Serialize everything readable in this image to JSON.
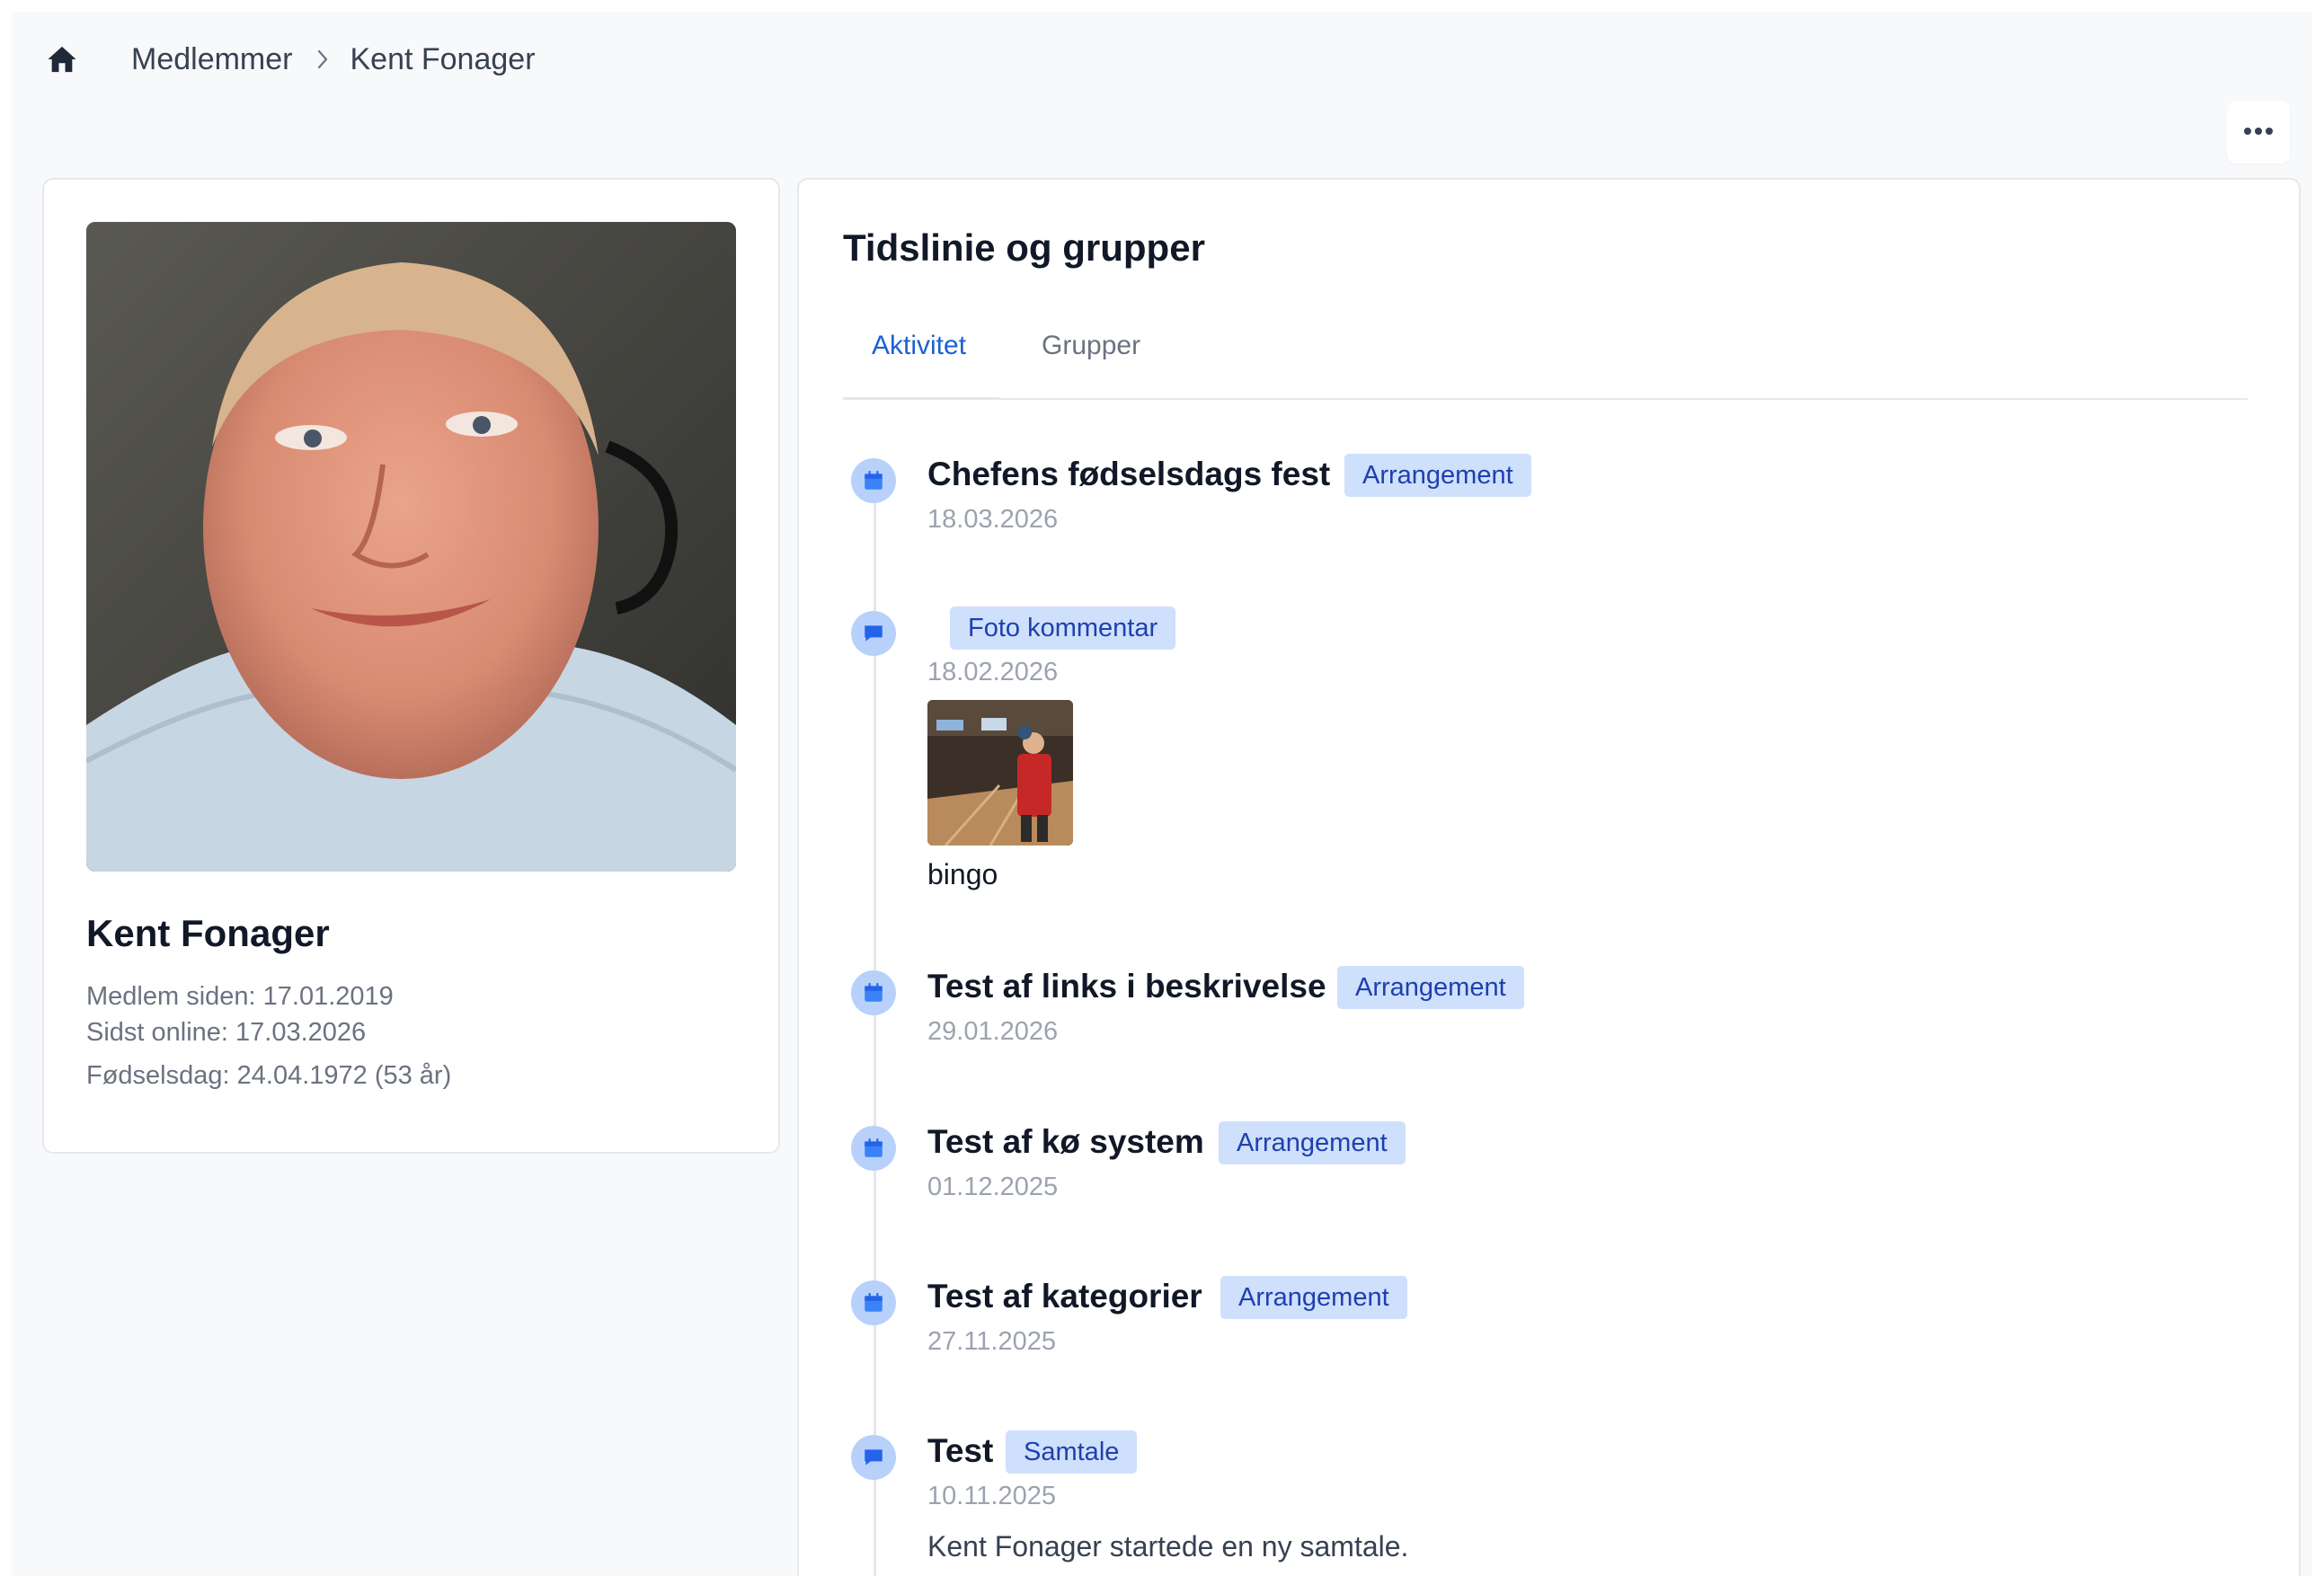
{
  "breadcrumb": {
    "home_icon": "home-icon",
    "items": [
      "Medlemmer",
      "Kent Fonager"
    ],
    "separator_icon": "chevron-right-icon"
  },
  "toolbar": {
    "more_icon": "more-horizontal-icon"
  },
  "profile": {
    "name": "Kent Fonager",
    "member_since": "Medlem siden: 17.01.2019",
    "last_online": "Sidst online: 17.03.2026",
    "birthday": "Fødselsdag: 24.04.1972 (53 år)"
  },
  "timeline": {
    "title": "Tidslinie og grupper",
    "tabs": [
      {
        "label": "Aktivitet",
        "active": true
      },
      {
        "label": "Grupper",
        "active": false
      }
    ],
    "items": [
      {
        "icon": "calendar-icon",
        "title": "Chefens fødselsdags fest",
        "badge": "Arrangement",
        "date": "18.03.2026"
      },
      {
        "icon": "comment-icon",
        "title": "",
        "badge": "Foto kommentar",
        "date": "18.02.2026",
        "caption": "bingo"
      },
      {
        "icon": "calendar-icon",
        "title": "Test af links i beskrivelse",
        "badge": "Arrangement",
        "date": "29.01.2026"
      },
      {
        "icon": "calendar-icon",
        "title": "Test af kø system",
        "badge": "Arrangement",
        "date": "01.12.2025"
      },
      {
        "icon": "calendar-icon",
        "title": "Test af kategorier",
        "badge": "Arrangement",
        "date": "27.11.2025"
      },
      {
        "icon": "comment-icon",
        "title": "Test",
        "badge": "Samtale",
        "date": "10.11.2025",
        "description": "Kent Fonager startede en ny samtale."
      }
    ]
  },
  "colors": {
    "accent": "#1d5fd6",
    "badge_bg": "#cfe0fc",
    "badge_text": "#1e40af",
    "icon_bg": "#b7d1fb",
    "page_bg": "#f8f9fb"
  }
}
